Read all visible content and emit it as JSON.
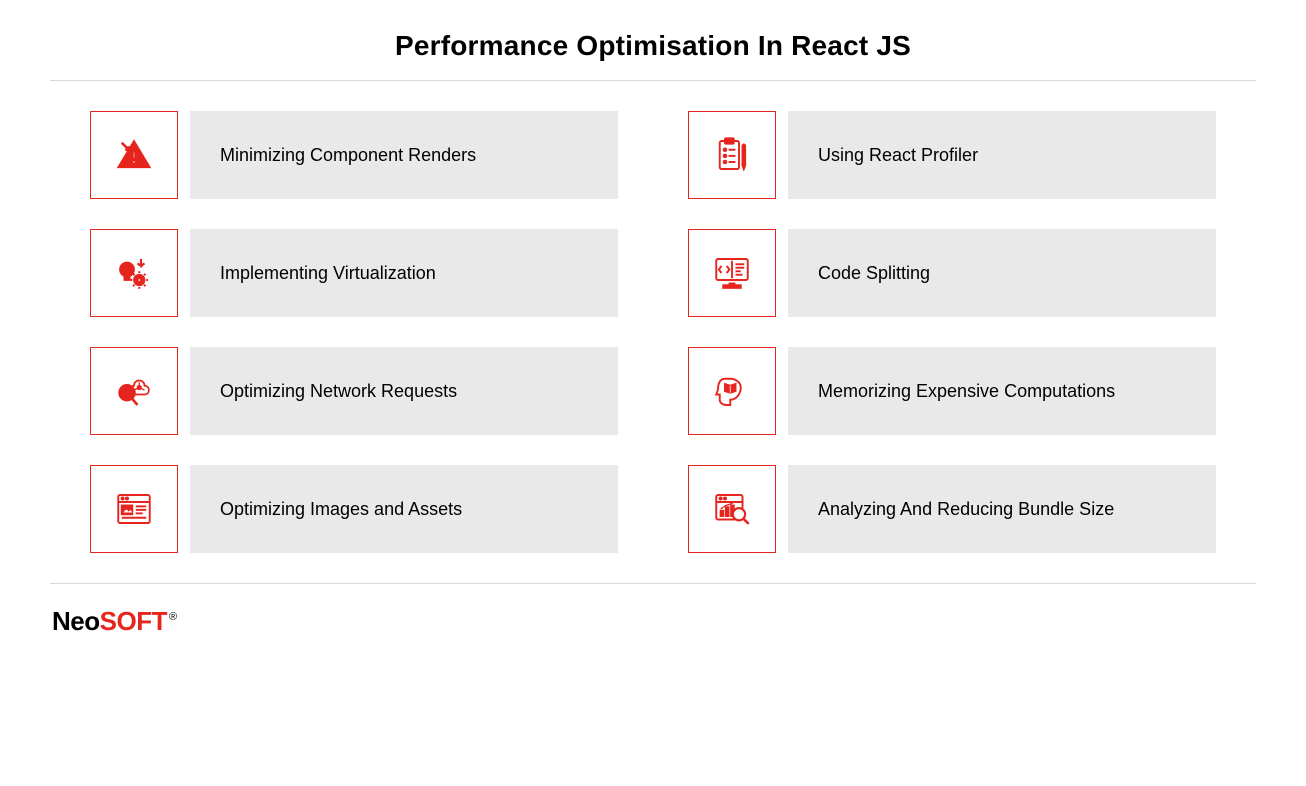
{
  "title": "Performance Optimisation In React JS",
  "colors": {
    "accent": "#e6251f",
    "card_bg": "#e9e9e9",
    "divider": "#d9d9d9"
  },
  "items": [
    {
      "label": "Minimizing Component Renders",
      "icon": "warning-triangle-icon"
    },
    {
      "label": "Using React Profiler",
      "icon": "clipboard-icon"
    },
    {
      "label": "Implementing Virtualization",
      "icon": "bulb-gear-icon"
    },
    {
      "label": "Code Splitting",
      "icon": "code-monitor-icon"
    },
    {
      "label": "Optimizing Network Requests",
      "icon": "seo-cloud-icon"
    },
    {
      "label": "Memorizing Expensive Computations",
      "icon": "head-book-icon"
    },
    {
      "label": "Optimizing Images and Assets",
      "icon": "image-page-icon"
    },
    {
      "label": "Analyzing And Reducing Bundle Size",
      "icon": "analytics-search-icon"
    }
  ],
  "logo": {
    "part1": "Neo",
    "part2": "SOFT",
    "registered": "®"
  }
}
